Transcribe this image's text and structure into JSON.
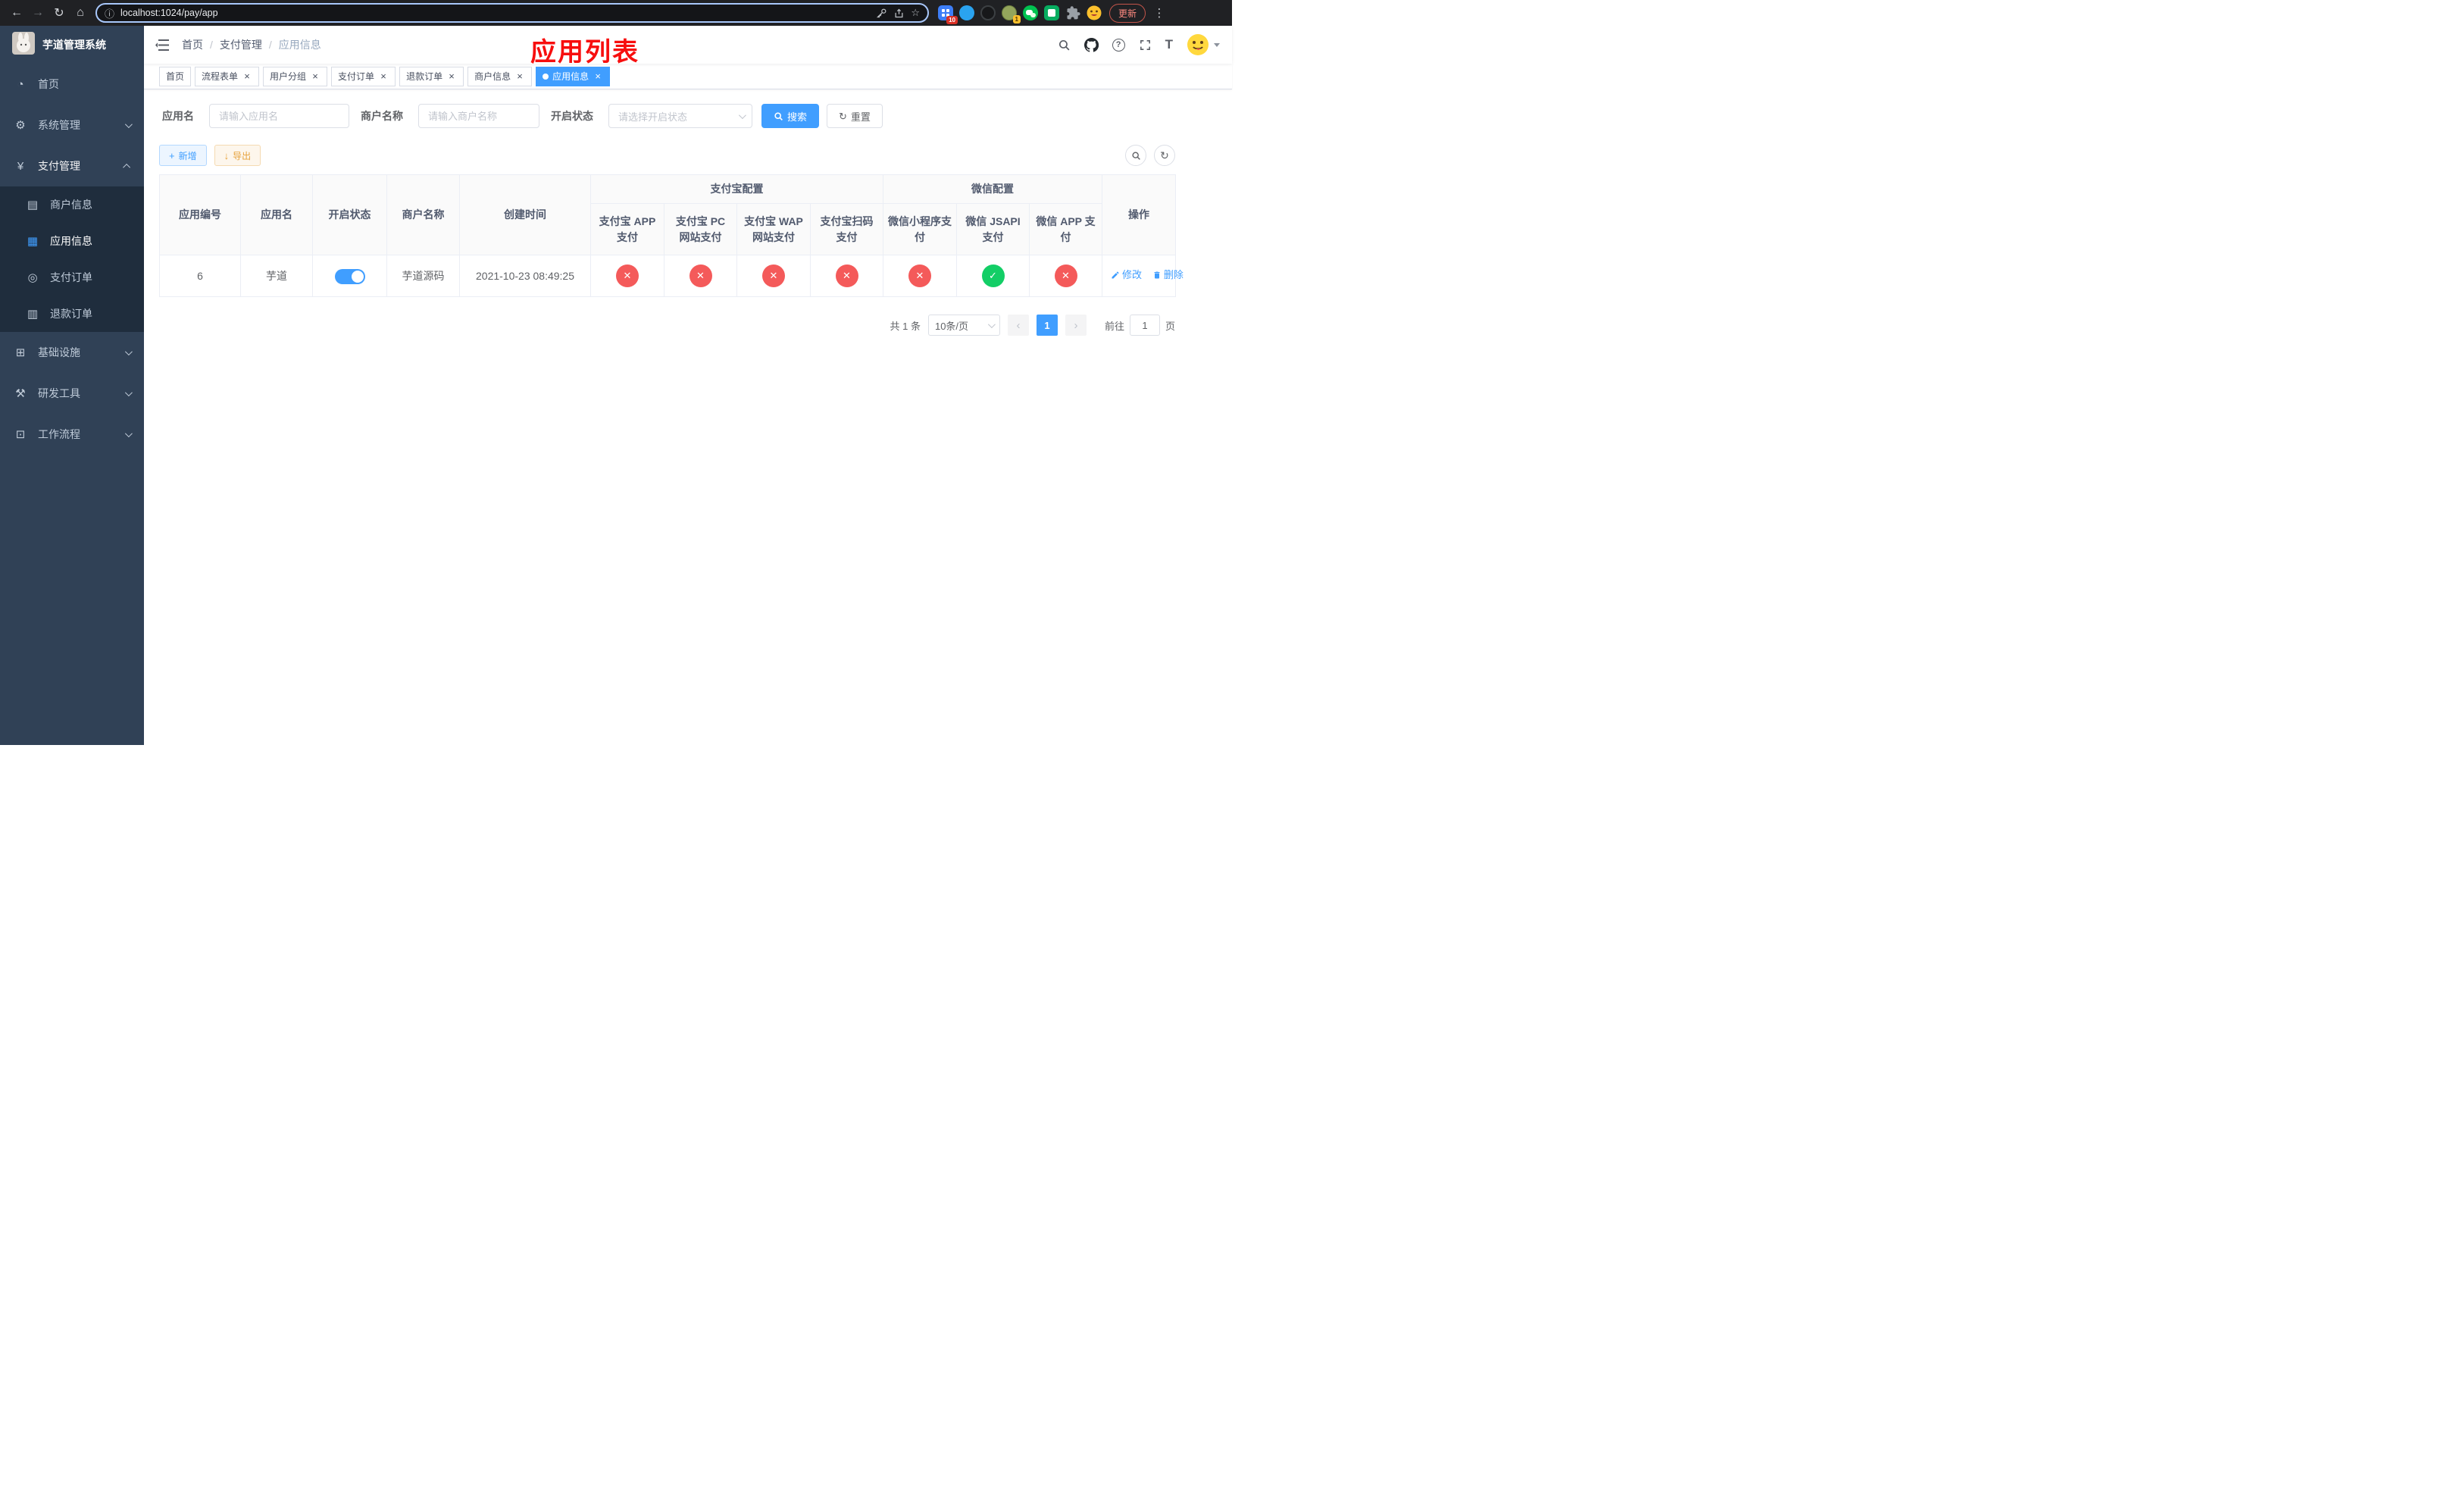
{
  "colors": {
    "accent": "#409eff",
    "danger": "#f45a5a",
    "success": "#13ce66",
    "warning": "#e6a23c",
    "sidebar_bg": "#304156",
    "annotation_red": "#f70e0e"
  },
  "icons": {
    "back": "←",
    "forward": "→",
    "reload": "↻",
    "home": "⌂",
    "info": "ⓘ",
    "star": "☆",
    "more": "⋮",
    "question": "?",
    "font_size": "T",
    "dashboard": "◔",
    "gear": "⚙",
    "yen": "¥",
    "merchant": "▤",
    "app": "▦",
    "order": "◎",
    "refund": "▥",
    "infra": "⊞",
    "tools": "⚒",
    "flow": "⊡",
    "close": "×",
    "plus": "+",
    "download": "↓",
    "refresh": "↻",
    "prev": "‹",
    "next": "›",
    "check": "✓",
    "cross": "✕"
  },
  "browser": {
    "url": "localhost:1024/pay/app",
    "update_label": "更新",
    "ext_badge_grid": "10",
    "ext_badge_avatar": "1"
  },
  "sidebar": {
    "title": "芋道管理系统",
    "items": [
      {
        "label": "首页"
      },
      {
        "label": "系统管理"
      },
      {
        "label": "支付管理"
      },
      {
        "label": "商户信息"
      },
      {
        "label": "应用信息"
      },
      {
        "label": "支付订单"
      },
      {
        "label": "退款订单"
      },
      {
        "label": "基础设施"
      },
      {
        "label": "研发工具"
      },
      {
        "label": "工作流程"
      }
    ]
  },
  "header": {
    "breadcrumb": [
      "首页",
      "支付管理",
      "应用信息"
    ],
    "separator": "/",
    "overlay_title": "应用列表"
  },
  "tabs": [
    {
      "label": "首页"
    },
    {
      "label": "流程表单"
    },
    {
      "label": "用户分组"
    },
    {
      "label": "支付订单"
    },
    {
      "label": "退款订单"
    },
    {
      "label": "商户信息"
    },
    {
      "label": "应用信息"
    }
  ],
  "filters": {
    "app_name_label": "应用名",
    "app_name_placeholder": "请输入应用名",
    "merchant_label": "商户名称",
    "merchant_placeholder": "请输入商户名称",
    "status_label": "开启状态",
    "status_placeholder": "请选择开启状态",
    "search_label": "搜索",
    "reset_label": "重置"
  },
  "toolbar": {
    "add_label": "新增",
    "export_label": "导出"
  },
  "table": {
    "main_columns": [
      "应用编号",
      "应用名",
      "开启状态",
      "商户名称",
      "创建时间"
    ],
    "group_alipay": "支付宝配置",
    "group_wechat": "微信配置",
    "sub_columns": [
      "支付宝 APP 支付",
      "支付宝 PC 网站支付",
      "支付宝 WAP 网站支付",
      "支付宝扫码支付",
      "微信小程序支付",
      "微信 JSAPI 支付",
      "微信 APP 支付"
    ],
    "op_column": "操作",
    "row": {
      "id": "6",
      "name": "芋道",
      "enabled": true,
      "merchant": "芋道源码",
      "created": "2021-10-23 08:49:25",
      "statuses": [
        false,
        false,
        false,
        false,
        false,
        true,
        false
      ],
      "edit_label": "修改",
      "delete_label": "删除"
    }
  },
  "pagination": {
    "total": "共 1 条",
    "page_size": "10条/页",
    "page": "1",
    "goto_prefix": "前往",
    "goto_value": "1",
    "goto_suffix": "页"
  }
}
